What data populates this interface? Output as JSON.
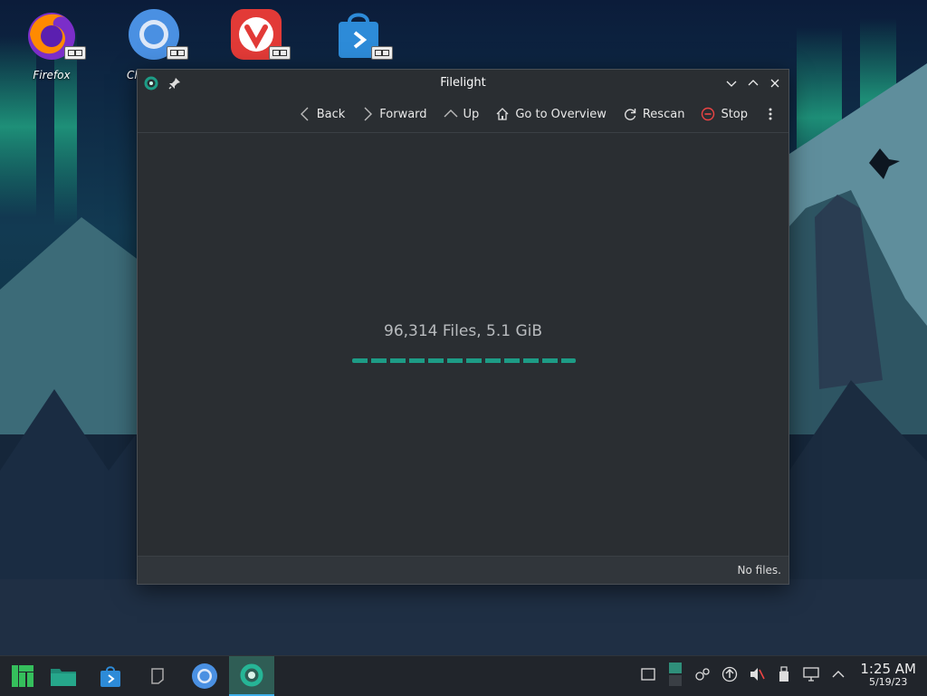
{
  "desktop": {
    "icons": [
      {
        "label": "Firefox"
      },
      {
        "label": "Ch"
      },
      {
        "label": ""
      },
      {
        "label": ""
      }
    ]
  },
  "window": {
    "title": "Filelight",
    "toolbar": {
      "back": "Back",
      "forward": "Forward",
      "up": "Up",
      "overview": "Go to Overview",
      "rescan": "Rescan",
      "stop": "Stop"
    },
    "scan_status": "96,314 Files, 5.1 GiB",
    "statusbar": "No files."
  },
  "taskbar": {
    "apps": [
      "manjaro-menu-icon",
      "files-icon",
      "store-icon",
      "notes-icon",
      "chromium-icon",
      "filelight-icon"
    ],
    "active_app": "filelight-icon",
    "clock": {
      "time": "1:25 AM",
      "date": "5/19/23"
    }
  },
  "colors": {
    "accent": "#1d9c86",
    "window_bg": "#2a2e32",
    "taskbar_bg": "#21252b"
  }
}
